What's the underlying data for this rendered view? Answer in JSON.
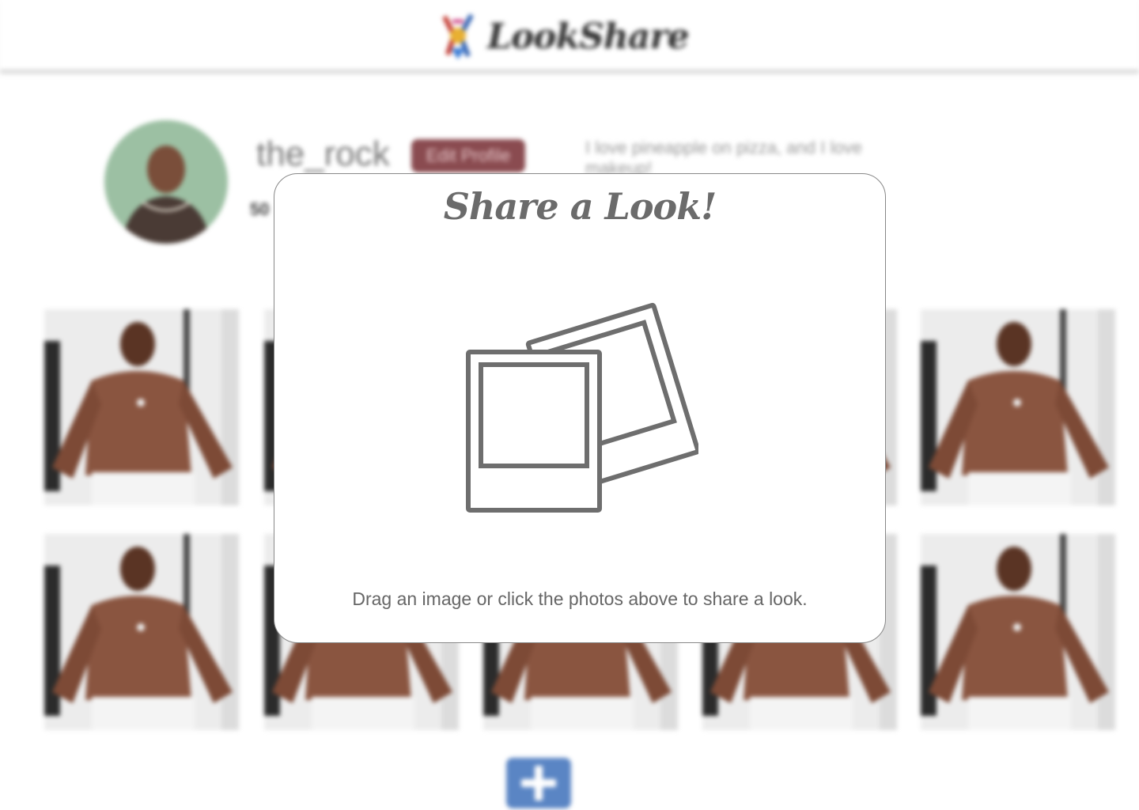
{
  "header": {
    "logo_text": "LookShare",
    "logo_icon": "hanger-bouquet-logo"
  },
  "profile": {
    "username": "the_rock",
    "edit_button_label": "Edit Profile",
    "bio": "I love pineapple on pizza, and I love makeup!",
    "stat_partial": "50"
  },
  "grid": {
    "photo_count_visible": 10
  },
  "add_button": {
    "icon": "plus-icon"
  },
  "modal": {
    "title": "Share a Look!",
    "upload_icon": "photos-icon",
    "hint": "Drag an image or click the photos above to share a look."
  },
  "colors": {
    "modal_title": "#6b6b6b",
    "edit_button": "#8a4b50",
    "add_button": "#5a85c4",
    "icon_stroke": "#6e6e6e"
  }
}
